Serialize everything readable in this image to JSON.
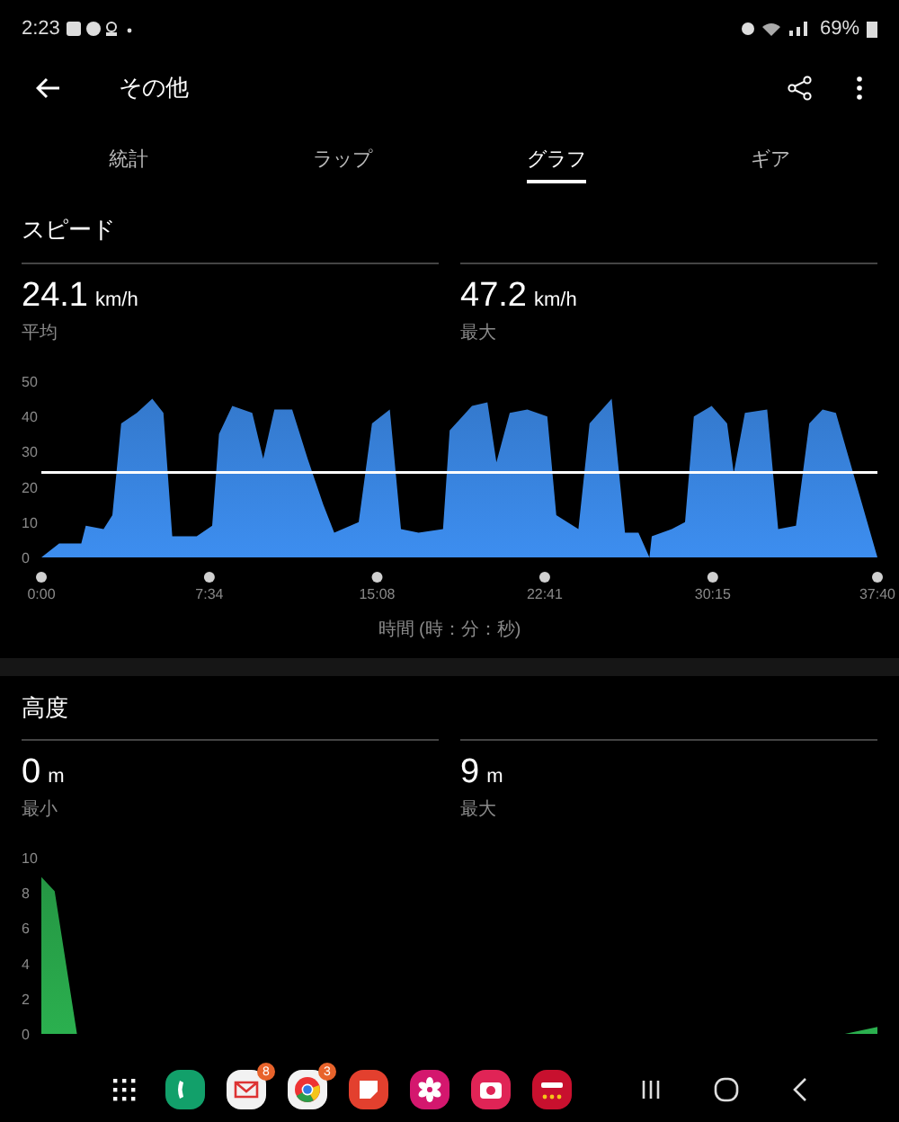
{
  "status_bar": {
    "time": "2:23",
    "battery": "69%"
  },
  "header": {
    "title": "その他"
  },
  "tabs": [
    {
      "label": "統計",
      "selected": false
    },
    {
      "label": "ラップ",
      "selected": false
    },
    {
      "label": "グラフ",
      "selected": true
    },
    {
      "label": "ギア",
      "selected": false
    }
  ],
  "sections": [
    {
      "title": "スピード",
      "stats": [
        {
          "value": "24.1",
          "unit": "km/h",
          "label": "平均"
        },
        {
          "value": "47.2",
          "unit": "km/h",
          "label": "最大"
        }
      ],
      "chart_data": {
        "type": "area",
        "xlabel": "時間 (時：分：秒)",
        "x": [
          0,
          0.8,
          1.8,
          2.0,
          2.8,
          3.2,
          3.6,
          4.3,
          5.0,
          5.5,
          5.9,
          7.0,
          7.7,
          8.0,
          8.6,
          9.5,
          10.0,
          10.5,
          11.3,
          12.0,
          12.7,
          13.2,
          14.3,
          14.9,
          15.7,
          16.2,
          17.0,
          18.1,
          18.4,
          19.4,
          20.1,
          20.5,
          21.1,
          21.9,
          22.8,
          23.2,
          24.2,
          24.7,
          25.7,
          26.3,
          26.9,
          27.4,
          27.5,
          28.4,
          29.0,
          29.4,
          30.2,
          30.9,
          31.2,
          31.7,
          32.7,
          33.2,
          34.0,
          34.6,
          35.2,
          35.8,
          36.3,
          37.67
        ],
        "series": [
          {
            "color": "#3d8ef0",
            "values": [
              0,
              4,
              4,
              9,
              8,
              12,
              38,
              41,
              45,
              41,
              6,
              6,
              9,
              35,
              43,
              41,
              28,
              42,
              42,
              28,
              15,
              7,
              10,
              38,
              42,
              8,
              7,
              8,
              36,
              43,
              44,
              27,
              41,
              42,
              40,
              12,
              8,
              38,
              45,
              7,
              7,
              0,
              6,
              8,
              10,
              40,
              43,
              38,
              24,
              41,
              42,
              8,
              9,
              38,
              42,
              41,
              30,
              0
            ]
          },
          {
            "type": "line",
            "color": "#ffffff",
            "values": [
              24.1,
              24.1,
              24.1,
              24.1,
              24.1,
              24.1,
              24.1,
              24.1,
              24.1,
              24.1,
              24.1,
              24.1,
              24.1,
              24.1,
              24.1,
              24.1,
              24.1,
              24.1,
              24.1,
              24.1,
              24.1,
              24.1,
              24.1,
              24.1,
              24.1,
              24.1,
              24.1,
              24.1,
              24.1,
              24.1,
              24.1,
              24.1,
              24.1,
              24.1,
              24.1,
              24.1,
              24.1,
              24.1,
              24.1,
              24.1,
              24.1,
              24.1,
              24.1,
              24.1,
              24.1,
              24.1,
              24.1,
              24.1,
              24.1,
              24.1,
              24.1,
              24.1,
              24.1,
              24.1,
              24.1,
              24.1,
              24.1,
              24.1
            ]
          }
        ],
        "xlim": [
          0,
          37.67
        ],
        "yticks": [
          0,
          10,
          20,
          30,
          40,
          50
        ],
        "xticks": [
          {
            "value": 0,
            "label": "0:00"
          },
          {
            "value": 7.57,
            "label": "7:34"
          },
          {
            "value": 15.13,
            "label": "15:08"
          },
          {
            "value": 22.68,
            "label": "22:41"
          },
          {
            "value": 30.25,
            "label": "30:15"
          },
          {
            "value": 37.67,
            "label": "37:40"
          }
        ],
        "ylim": [
          0,
          50
        ]
      }
    },
    {
      "title": "高度",
      "stats": [
        {
          "value": "0",
          "unit": "m",
          "label": "最小"
        },
        {
          "value": "9",
          "unit": "m",
          "label": "最大"
        }
      ],
      "chart_data": {
        "type": "area",
        "x": [
          0,
          0.6,
          1.6,
          36.2,
          37.67
        ],
        "series": [
          {
            "color": "#2bb04f",
            "values": [
              8.9,
              8.1,
              0,
              0,
              0.4
            ]
          }
        ],
        "xlim": [
          0,
          37.67
        ],
        "ylim": [
          0,
          10
        ],
        "yticks": [
          0,
          2,
          4,
          6,
          8,
          10
        ]
      }
    }
  ],
  "dock_apps": [
    {
      "kind": "grid"
    },
    {
      "kind": "phone"
    },
    {
      "kind": "mail",
      "badge": "8"
    },
    {
      "kind": "chrome",
      "badge": "3"
    },
    {
      "kind": "note"
    },
    {
      "kind": "flower"
    },
    {
      "kind": "camera"
    },
    {
      "kind": "dmenu"
    }
  ],
  "nav_buttons": [
    {
      "kind": "recents"
    },
    {
      "kind": "home"
    },
    {
      "kind": "back"
    }
  ]
}
